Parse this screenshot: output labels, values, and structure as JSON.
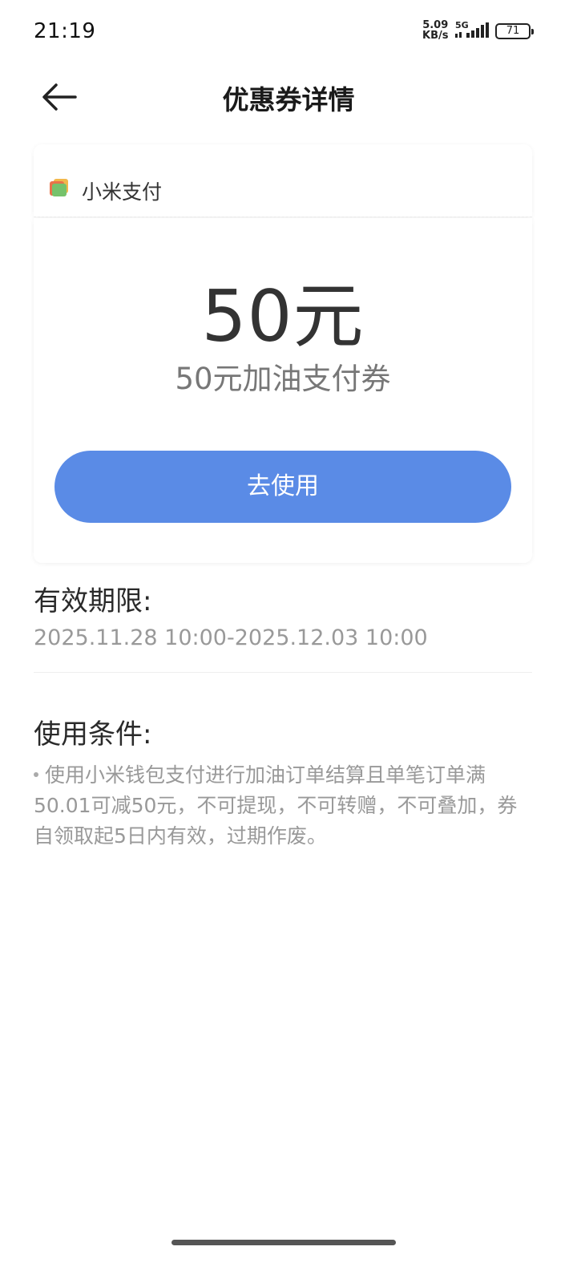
{
  "status_bar": {
    "time": "21:19",
    "net_speed_value": "5.09",
    "net_speed_unit": "KB/s",
    "network_type": "5G",
    "battery_level": "71"
  },
  "header": {
    "title": "优惠券详情"
  },
  "coupon": {
    "brand_name": "小米支付",
    "amount": "50元",
    "name": "50元加油支付券",
    "use_button_label": "去使用"
  },
  "validity": {
    "title": "有效期限:",
    "value": "2025.11.28 10:00-2025.12.03 10:00"
  },
  "conditions": {
    "title": "使用条件:",
    "text": "使用小米钱包支付进行加油订单结算且单笔订单满50.01可减50元，不可提现，不可转赠，不可叠加，券自领取起5日内有效，过期作废。"
  },
  "colors": {
    "accent": "#5a8be6",
    "title_text": "#1a1a1a",
    "secondary_text": "#999999"
  }
}
